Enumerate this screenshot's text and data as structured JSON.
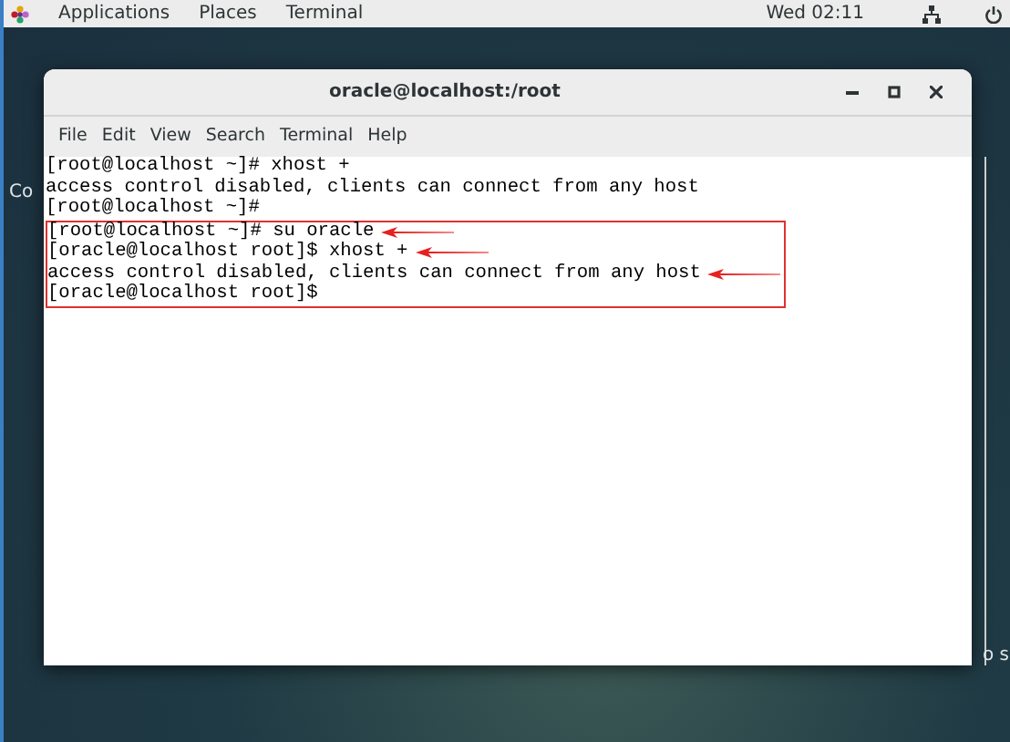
{
  "top_bar": {
    "menus": [
      "Applications",
      "Places",
      "Terminal"
    ],
    "clock": "Wed 02:11"
  },
  "desktop_labels": [
    "Co",
    "o s"
  ],
  "window": {
    "title": "oracle@localhost:/root",
    "menu": [
      "File",
      "Edit",
      "View",
      "Search",
      "Terminal",
      "Help"
    ]
  },
  "terminal_lines": [
    {
      "text": "[root@localhost ~]# xhost +",
      "highlighted": false,
      "arrow": false
    },
    {
      "text": "access control disabled, clients can connect from any host",
      "highlighted": false,
      "arrow": false
    },
    {
      "text": "[root@localhost ~]#",
      "highlighted": false,
      "arrow": false
    },
    {
      "text": "[root@localhost ~]# su oracle",
      "highlighted": true,
      "arrow": true
    },
    {
      "text": "[oracle@localhost root]$ xhost +",
      "highlighted": true,
      "arrow": true
    },
    {
      "text": "access control disabled, clients can connect from any host",
      "highlighted": true,
      "arrow": true
    },
    {
      "text": "[oracle@localhost root]$",
      "highlighted": true,
      "arrow": false
    }
  ]
}
